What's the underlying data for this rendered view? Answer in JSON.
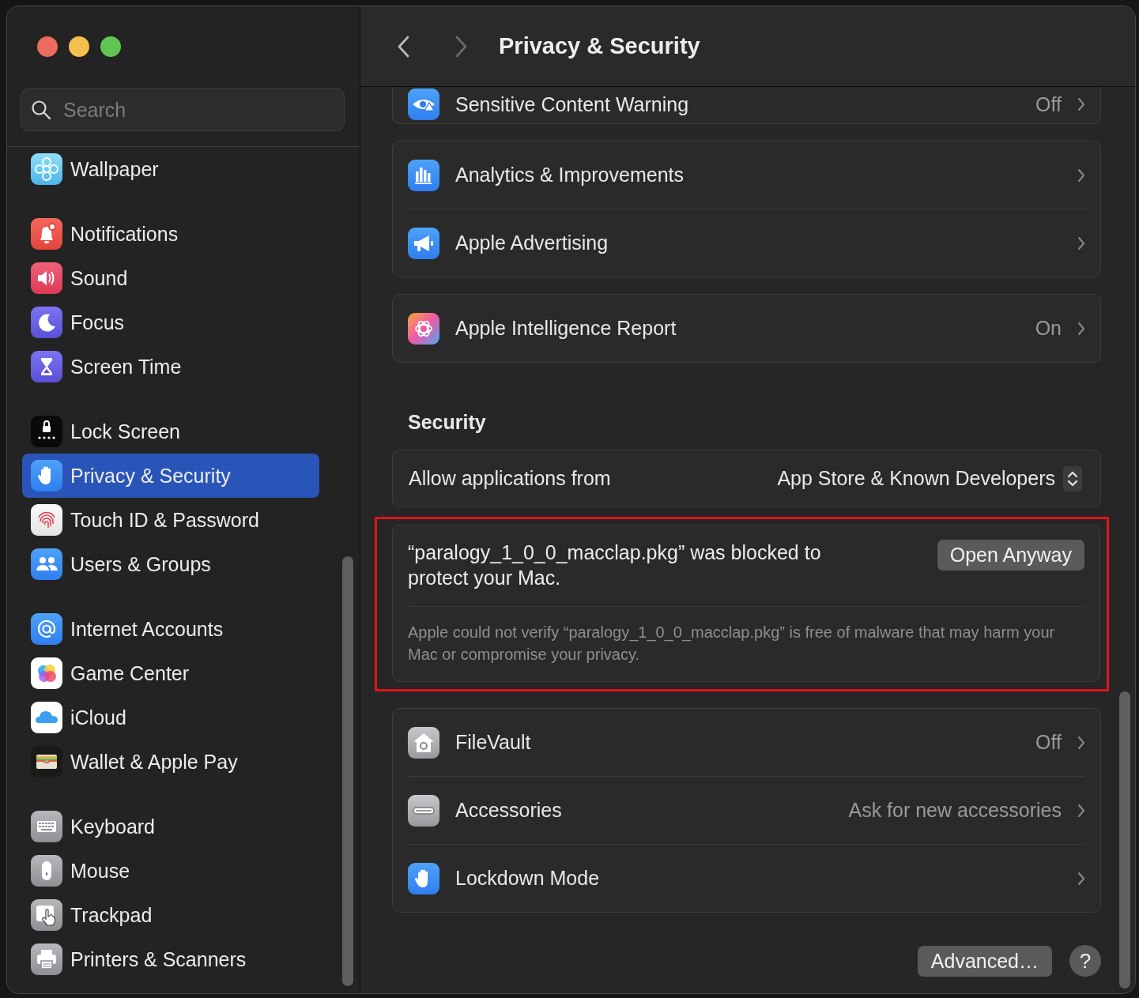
{
  "window": {
    "title": "Privacy & Security"
  },
  "sidebar": {
    "search": {
      "placeholder": "Search"
    },
    "groups": [
      {
        "items": [
          {
            "label": "Wallpaper",
            "selected": false
          }
        ]
      },
      {
        "items": [
          {
            "label": "Notifications",
            "selected": false
          },
          {
            "label": "Sound",
            "selected": false
          },
          {
            "label": "Focus",
            "selected": false
          },
          {
            "label": "Screen Time",
            "selected": false
          }
        ]
      },
      {
        "items": [
          {
            "label": "Lock Screen",
            "selected": false
          },
          {
            "label": "Privacy & Security",
            "selected": true
          },
          {
            "label": "Touch ID & Password",
            "selected": false
          },
          {
            "label": "Users & Groups",
            "selected": false
          }
        ]
      },
      {
        "items": [
          {
            "label": "Internet Accounts",
            "selected": false
          },
          {
            "label": "Game Center",
            "selected": false
          },
          {
            "label": "iCloud",
            "selected": false
          },
          {
            "label": "Wallet & Apple Pay",
            "selected": false
          }
        ]
      },
      {
        "items": [
          {
            "label": "Keyboard",
            "selected": false
          },
          {
            "label": "Mouse",
            "selected": false
          },
          {
            "label": "Trackpad",
            "selected": false
          },
          {
            "label": "Printers & Scanners",
            "selected": false
          }
        ]
      }
    ]
  },
  "privacy_cards": [
    {
      "rows": [
        {
          "label": "Sensitive Content Warning",
          "value": "Off"
        }
      ]
    },
    {
      "rows": [
        {
          "label": "Analytics & Improvements"
        },
        {
          "label": "Apple Advertising"
        }
      ]
    },
    {
      "rows": [
        {
          "label": "Apple Intelligence Report",
          "value": "On"
        }
      ]
    }
  ],
  "security": {
    "heading": "Security",
    "allow_row": {
      "label": "Allow applications from",
      "value": "App Store & Known Developers"
    },
    "blocked_notice": {
      "message": "“paralogy_1_0_0_macclap.pkg” was blocked to protect your Mac.",
      "button": "Open Anyway",
      "detail": "Apple could not verify “paralogy_1_0_0_macclap.pkg” is free of malware that may harm your Mac or compromise your privacy."
    },
    "rows": [
      {
        "label": "FileVault",
        "value": "Off"
      },
      {
        "label": "Accessories",
        "value": "Ask for new accessories"
      },
      {
        "label": "Lockdown Mode"
      }
    ]
  },
  "footer": {
    "advanced_button": "Advanced…",
    "help_button": "?"
  }
}
